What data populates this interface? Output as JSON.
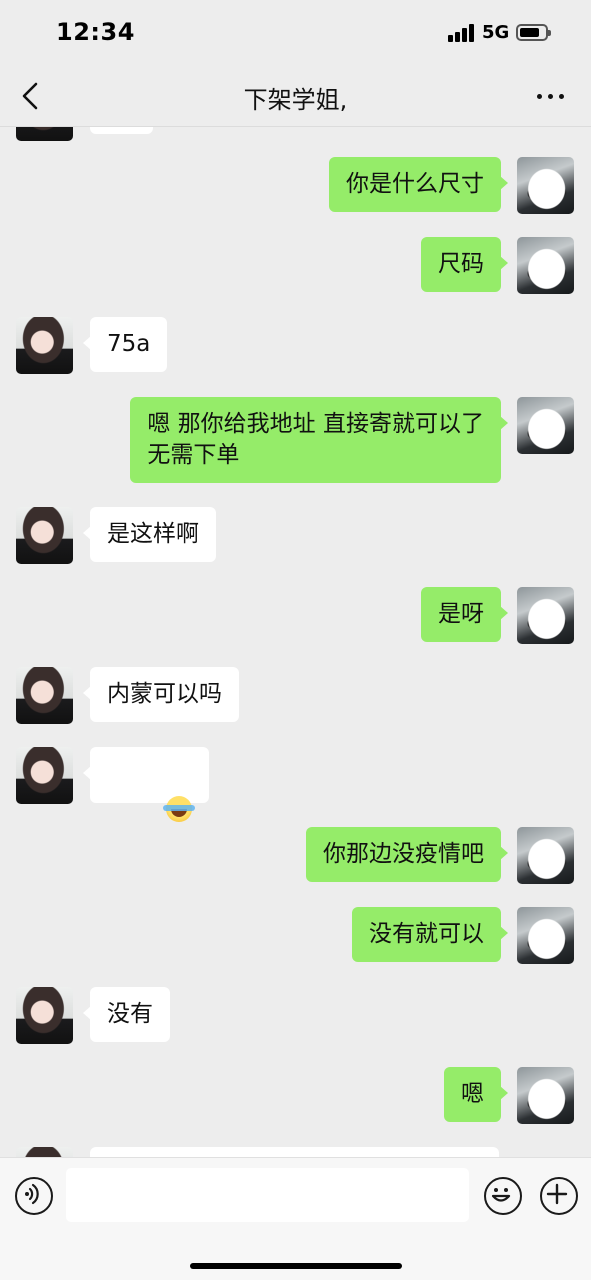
{
  "status_bar": {
    "time": "12:34",
    "network": "5G",
    "battery_level": 0.8
  },
  "nav": {
    "title": "下架学姐,",
    "back_icon": "chevron-left-icon",
    "more_icon": "more-dots-icon"
  },
  "messages": [
    {
      "side": "left",
      "text": ""
    },
    {
      "side": "right",
      "text": "你是什么尺寸"
    },
    {
      "side": "right",
      "text": "尺码"
    },
    {
      "side": "left",
      "text": "75a"
    },
    {
      "side": "right",
      "text": "嗯 那你给我地址 直接寄就可以了\n无需下单"
    },
    {
      "side": "left",
      "text": "是这样啊"
    },
    {
      "side": "right",
      "text": "是呀"
    },
    {
      "side": "left",
      "text": "内蒙可以吗"
    },
    {
      "side": "left",
      "text": "",
      "emoji": "crying-laughing-emoji"
    },
    {
      "side": "right",
      "text": "你那边没疫情吧"
    },
    {
      "side": "right",
      "text": "没有就可以"
    },
    {
      "side": "left",
      "text": "没有"
    },
    {
      "side": "right",
      "text": "嗯"
    },
    {
      "side": "left",
      "text": ""
    }
  ],
  "input_bar": {
    "voice_icon": "voice-icon",
    "emoji_icon": "emoji-icon",
    "plus_icon": "plus-icon",
    "placeholder": ""
  },
  "colors": {
    "background": "#ededed",
    "outgoing_bubble": "#95ec69",
    "incoming_bubble": "#ffffff"
  }
}
